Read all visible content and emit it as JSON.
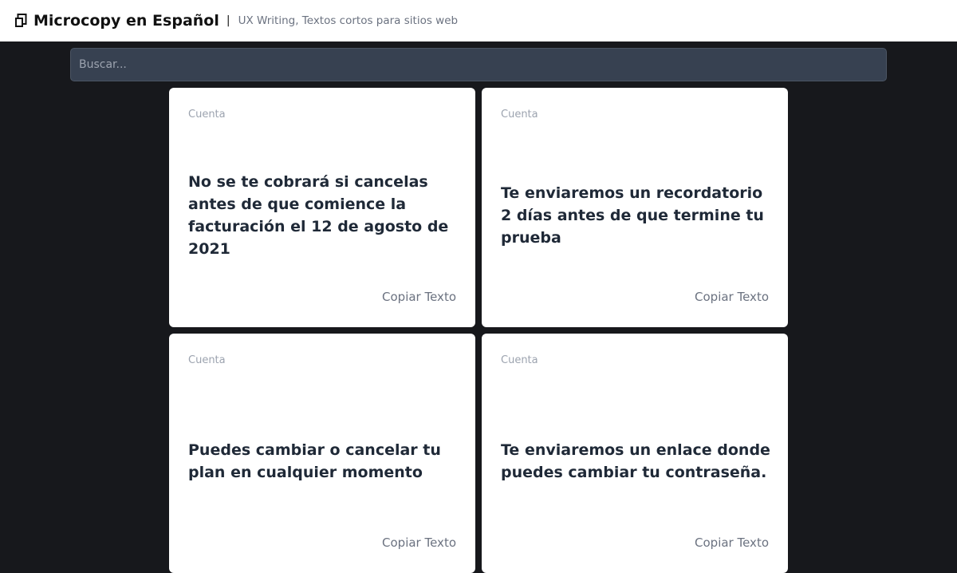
{
  "header": {
    "brand": "Microcopy en Español",
    "divider": "|",
    "tagline": "UX Writing, Textos cortos para sitios web",
    "logo_icon": "copy-icon"
  },
  "search": {
    "placeholder": "Buscar...",
    "value": ""
  },
  "cards": [
    {
      "category": "Cuenta",
      "text": "No se te cobrará si cancelas antes de que comience la facturación el 12 de agosto de 2021",
      "copy_label": "Copiar Texto"
    },
    {
      "category": "Cuenta",
      "text": "Te enviaremos un recordatorio 2 días antes de que termine tu prueba",
      "copy_label": "Copiar Texto"
    },
    {
      "category": "Cuenta",
      "text": "Puedes cambiar o cancelar tu plan en cualquier momento",
      "copy_label": "Copiar Texto"
    },
    {
      "category": "Cuenta",
      "text": "Te enviaremos un enlace donde puedes cambiar tu contraseña.",
      "copy_label": "Copiar Texto"
    }
  ],
  "colors": {
    "page_background": "#17181c",
    "header_background": "#ffffff",
    "search_background": "#374151",
    "card_background": "#ffffff",
    "card_text": "#1f2937",
    "muted_text": "#9ca3af"
  }
}
